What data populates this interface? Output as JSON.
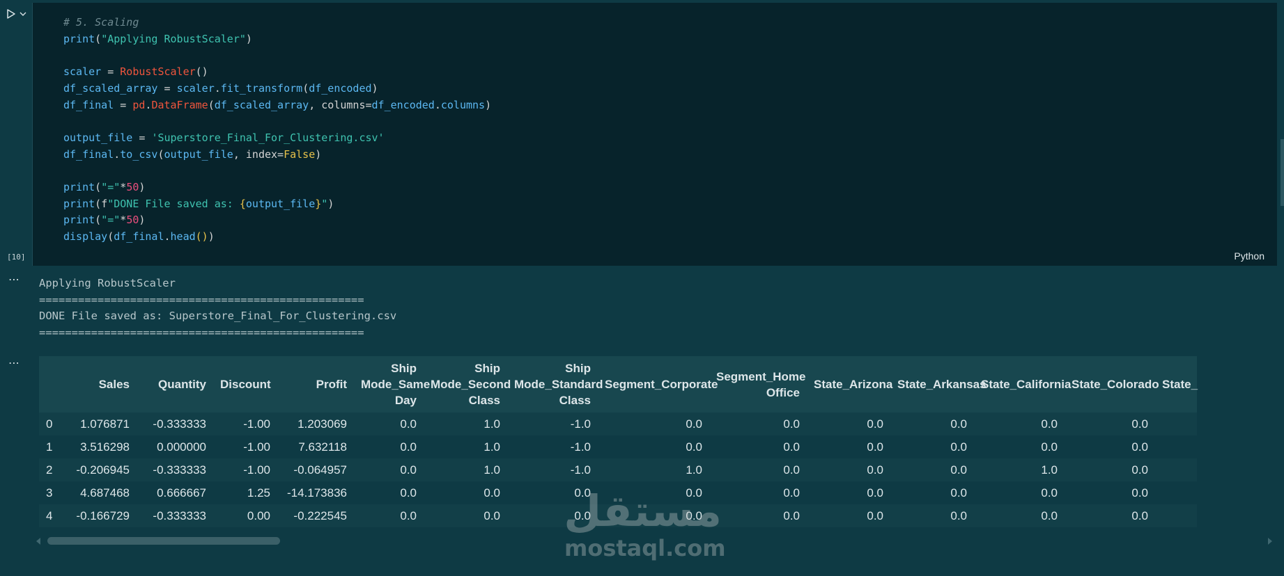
{
  "cell": {
    "execution_count": "[10]",
    "language": "Python",
    "code_lines": [
      [
        {
          "t": "# 5. Scaling",
          "c": "com"
        }
      ],
      [
        {
          "t": "print",
          "c": "fn"
        },
        {
          "t": "(",
          "c": "pl"
        },
        {
          "t": "\"Applying RobustScaler\"",
          "c": "str"
        },
        {
          "t": ")",
          "c": "pl"
        }
      ],
      [],
      [
        {
          "t": "scaler",
          "c": "var"
        },
        {
          "t": " = ",
          "c": "pl"
        },
        {
          "t": "RobustScaler",
          "c": "cls"
        },
        {
          "t": "()",
          "c": "pl"
        }
      ],
      [
        {
          "t": "df_scaled_array",
          "c": "var"
        },
        {
          "t": " = ",
          "c": "pl"
        },
        {
          "t": "scaler",
          "c": "var"
        },
        {
          "t": ".",
          "c": "pl"
        },
        {
          "t": "fit_transform",
          "c": "fn"
        },
        {
          "t": "(",
          "c": "pl"
        },
        {
          "t": "df_encoded",
          "c": "var"
        },
        {
          "t": ")",
          "c": "pl"
        }
      ],
      [
        {
          "t": "df_final",
          "c": "var"
        },
        {
          "t": " = ",
          "c": "pl"
        },
        {
          "t": "pd",
          "c": "cls"
        },
        {
          "t": ".",
          "c": "pl"
        },
        {
          "t": "DataFrame",
          "c": "cls"
        },
        {
          "t": "(",
          "c": "pl"
        },
        {
          "t": "df_scaled_array",
          "c": "var"
        },
        {
          "t": ", columns=",
          "c": "pl"
        },
        {
          "t": "df_encoded",
          "c": "var"
        },
        {
          "t": ".",
          "c": "pl"
        },
        {
          "t": "columns",
          "c": "var"
        },
        {
          "t": ")",
          "c": "pl"
        }
      ],
      [],
      [
        {
          "t": "output_file",
          "c": "var"
        },
        {
          "t": " = ",
          "c": "pl"
        },
        {
          "t": "'Superstore_Final_For_Clustering.csv'",
          "c": "str"
        }
      ],
      [
        {
          "t": "df_final",
          "c": "var"
        },
        {
          "t": ".",
          "c": "pl"
        },
        {
          "t": "to_csv",
          "c": "fn"
        },
        {
          "t": "(",
          "c": "pl"
        },
        {
          "t": "output_file",
          "c": "var"
        },
        {
          "t": ", index=",
          "c": "pl"
        },
        {
          "t": "False",
          "c": "kw"
        },
        {
          "t": ")",
          "c": "pl"
        }
      ],
      [],
      [
        {
          "t": "print",
          "c": "fn"
        },
        {
          "t": "(",
          "c": "pl"
        },
        {
          "t": "\"=\"",
          "c": "str"
        },
        {
          "t": "*",
          "c": "pl"
        },
        {
          "t": "50",
          "c": "num"
        },
        {
          "t": ")",
          "c": "pl"
        }
      ],
      [
        {
          "t": "print",
          "c": "fn"
        },
        {
          "t": "(",
          "c": "pl"
        },
        {
          "t": "f",
          "c": "pl"
        },
        {
          "t": "\"DONE File saved as: ",
          "c": "str"
        },
        {
          "t": "{",
          "c": "br"
        },
        {
          "t": "output_file",
          "c": "var"
        },
        {
          "t": "}",
          "c": "br"
        },
        {
          "t": "\"",
          "c": "str"
        },
        {
          "t": ")",
          "c": "pl"
        }
      ],
      [
        {
          "t": "print",
          "c": "fn"
        },
        {
          "t": "(",
          "c": "pl"
        },
        {
          "t": "\"=\"",
          "c": "str"
        },
        {
          "t": "*",
          "c": "pl"
        },
        {
          "t": "50",
          "c": "num"
        },
        {
          "t": ")",
          "c": "pl"
        }
      ],
      [
        {
          "t": "display",
          "c": "fn"
        },
        {
          "t": "(",
          "c": "pl"
        },
        {
          "t": "df_final",
          "c": "var"
        },
        {
          "t": ".",
          "c": "pl"
        },
        {
          "t": "head",
          "c": "fn"
        },
        {
          "t": "()",
          "c": "br"
        },
        {
          "t": ")",
          "c": "pl"
        }
      ]
    ]
  },
  "output": {
    "stdout_lines": [
      "Applying RobustScaler",
      "==================================================",
      "DONE File saved as: Superstore_Final_For_Clustering.csv",
      "=================================================="
    ],
    "more_icon": "ellipsis-icon"
  },
  "table": {
    "columns": [
      "",
      "Sales",
      "Quantity",
      "Discount",
      "Profit",
      "Ship Mode_Same Day",
      "Ship Mode_Second Class",
      "Ship Mode_Standard Class",
      "Segment_Corporate",
      "Segment_Home Office",
      "State_Arizona",
      "State_Arkansas",
      "State_California",
      "State_Colorado",
      "State_"
    ],
    "rows": [
      [
        "0",
        "1.076871",
        "-0.333333",
        "-1.00",
        "1.203069",
        "0.0",
        "1.0",
        "-1.0",
        "0.0",
        "0.0",
        "0.0",
        "0.0",
        "0.0",
        "0.0",
        ""
      ],
      [
        "1",
        "3.516298",
        "0.000000",
        "-1.00",
        "7.632118",
        "0.0",
        "1.0",
        "-1.0",
        "0.0",
        "0.0",
        "0.0",
        "0.0",
        "0.0",
        "0.0",
        ""
      ],
      [
        "2",
        "-0.206945",
        "-0.333333",
        "-1.00",
        "-0.064957",
        "0.0",
        "1.0",
        "-1.0",
        "1.0",
        "0.0",
        "0.0",
        "0.0",
        "1.0",
        "0.0",
        ""
      ],
      [
        "3",
        "4.687468",
        "0.666667",
        "1.25",
        "-14.173836",
        "0.0",
        "0.0",
        "0.0",
        "0.0",
        "0.0",
        "0.0",
        "0.0",
        "0.0",
        "0.0",
        ""
      ],
      [
        "4",
        "-0.166729",
        "-0.333333",
        "0.00",
        "-0.222545",
        "0.0",
        "0.0",
        "0.0",
        "0.0",
        "0.0",
        "0.0",
        "0.0",
        "0.0",
        "0.0",
        ""
      ]
    ]
  },
  "watermark": {
    "arabic": "مستقل",
    "latin": "mostaql.com"
  },
  "icons": {
    "run": "play-icon",
    "run_menu": "chevron-down-icon"
  }
}
